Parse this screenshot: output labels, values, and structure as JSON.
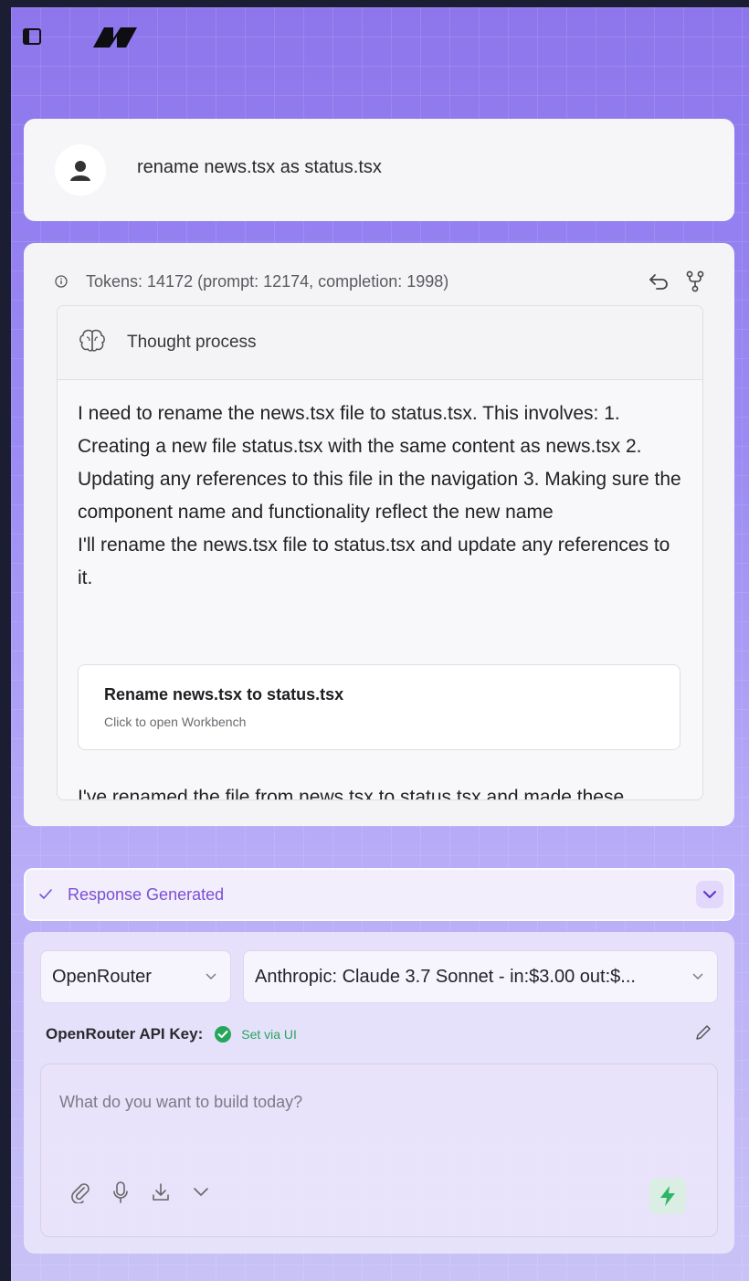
{
  "user_message": {
    "text": "rename news.tsx as status.tsx"
  },
  "response": {
    "tokens_text": "Tokens: 14172 (prompt: 12174, completion: 1998)",
    "thought_label": "Thought process",
    "paragraphs": [
      "I need to rename the news.tsx file to status.tsx. This involves: 1. Creating a new file status.tsx with the same content as news.tsx 2. Updating any references to this file in the navigation 3. Making sure the component name and functionality reflect the new name",
      "I'll rename the news.tsx file to status.tsx and update any references to it."
    ],
    "artifact": {
      "title": "Rename news.tsx to status.tsx",
      "subtitle": "Click to open Workbench"
    },
    "trailing_text": "I've renamed the file from news.tsx to status.tsx and made these"
  },
  "status": {
    "label": "Response Generated"
  },
  "composer": {
    "provider": "OpenRouter",
    "model": "Anthropic: Claude 3.7 Sonnet - in:$3.00 out:$...",
    "api_key_label": "OpenRouter API Key:",
    "api_key_status": "Set via UI",
    "placeholder": "What do you want to build today?"
  },
  "colors": {
    "accent": "#7a4fd6",
    "success": "#26a65b",
    "background": "#9b8bf3"
  }
}
